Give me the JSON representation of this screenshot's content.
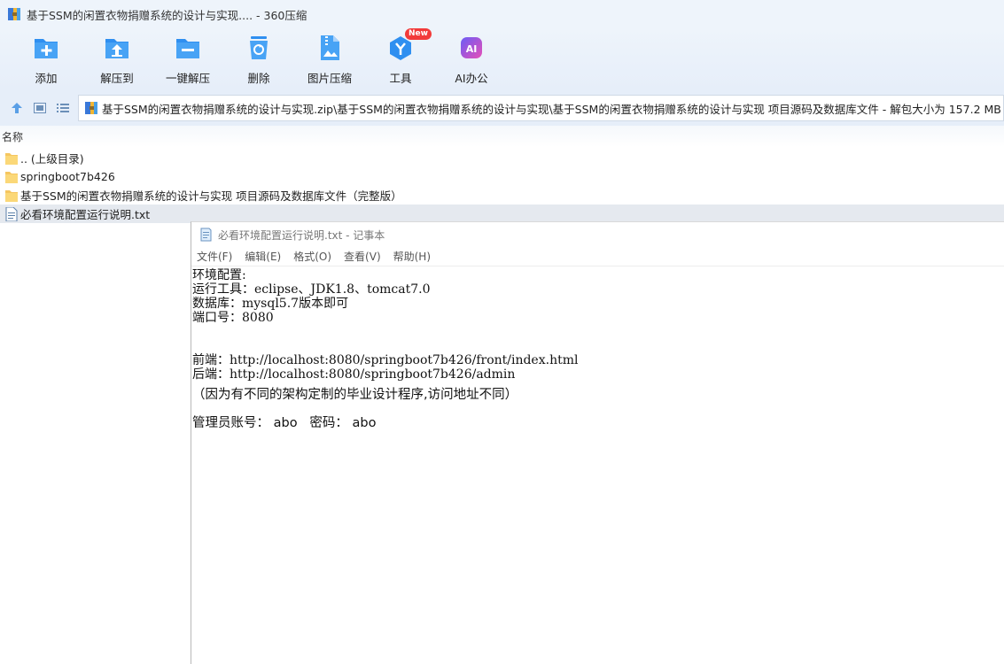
{
  "window": {
    "title": "基于SSM的闲置衣物捐赠系统的设计与实现.... - 360压缩"
  },
  "toolbar": {
    "items": [
      {
        "label": "添加",
        "icon": "add-folder-icon"
      },
      {
        "label": "解压到",
        "icon": "extract-to-icon"
      },
      {
        "label": "一键解压",
        "icon": "one-click-extract-icon"
      },
      {
        "label": "删除",
        "icon": "recycle-bin-icon"
      },
      {
        "label": "图片压缩",
        "icon": "image-compress-icon"
      },
      {
        "label": "工具",
        "icon": "tools-icon",
        "badge": "New"
      },
      {
        "label": "AI办公",
        "icon": "ai-office-icon",
        "glyph": "AI"
      }
    ]
  },
  "address": {
    "path": "基于SSM的闲置衣物捐赠系统的设计与实现.zip\\基于SSM的闲置衣物捐赠系统的设计与实现\\基于SSM的闲置衣物捐赠系统的设计与实现 项目源码及数据库文件 - 解包大小为 157.2 MB"
  },
  "list": {
    "column_name": "名称",
    "rows": [
      {
        "name": ".. (上级目录)",
        "type": "folder"
      },
      {
        "name": "springboot7b426",
        "type": "folder"
      },
      {
        "name": "基于SSM的闲置衣物捐赠系统的设计与实现 项目源码及数据库文件（完整版）",
        "type": "folder"
      },
      {
        "name": "必看环境配置运行说明.txt",
        "type": "text-file"
      }
    ]
  },
  "notepad": {
    "title": "必看环境配置运行说明.txt - 记事本",
    "menu": [
      "文件(F)",
      "编辑(E)",
      "格式(O)",
      "查看(V)",
      "帮助(H)"
    ],
    "lines": {
      "l1": "环境配置:",
      "l2": "运行工具：eclipse、JDK1.8、tomcat7.0",
      "l3": "数据库：mysql5.7版本即可",
      "l4": "端口号：8080",
      "l5": "前端：http://localhost:8080/springboot7b426/front/index.html",
      "l6": "后端：http://localhost:8080/springboot7b426/admin",
      "l7": "（因为有不同的架构定制的毕业设计程序,访问地址不同）",
      "l8": "管理员账号： abo   密码： abo"
    }
  },
  "colors": {
    "toolbar_bg": "#e6eef9",
    "icon_blue": "#2f8ff0",
    "badge_red": "#f23a3a",
    "selection": "#e5e9ef"
  }
}
